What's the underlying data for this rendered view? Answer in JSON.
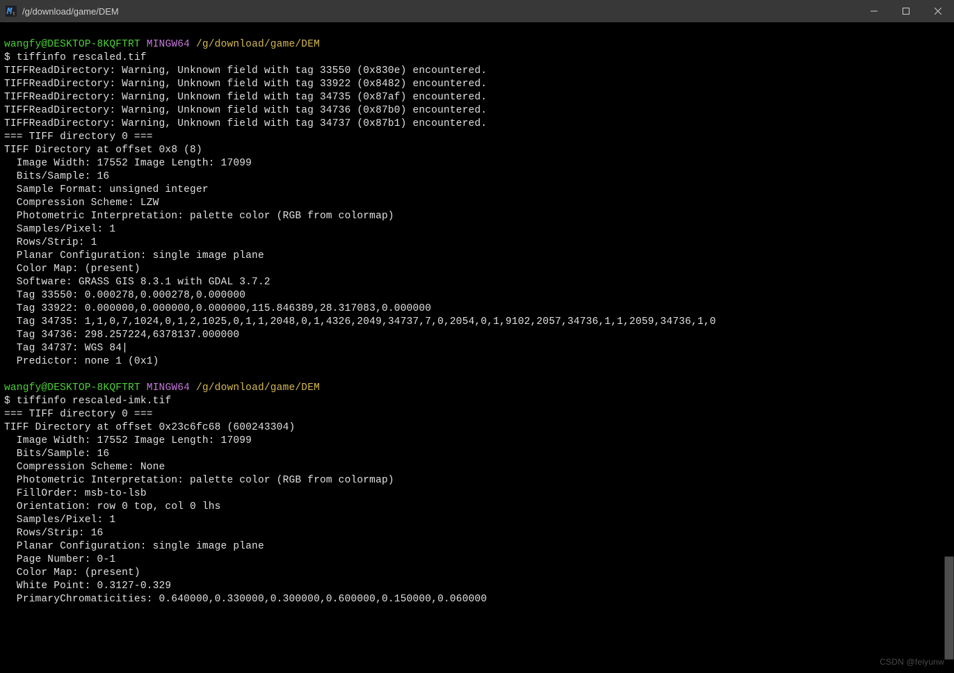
{
  "window": {
    "title": "/g/download/game/DEM",
    "icon_label": "M"
  },
  "prompt": {
    "user_host": "wangfy@DESKTOP-8KQFTRT",
    "system": "MINGW64",
    "cwd": "/g/download/game/DEM",
    "sigil": "$"
  },
  "commands": [
    {
      "cmd": "tiffinfo rescaled.tif"
    },
    {
      "cmd": "tiffinfo rescaled-imk.tif"
    }
  ],
  "output1": [
    "TIFFReadDirectory: Warning, Unknown field with tag 33550 (0x830e) encountered.",
    "TIFFReadDirectory: Warning, Unknown field with tag 33922 (0x8482) encountered.",
    "TIFFReadDirectory: Warning, Unknown field with tag 34735 (0x87af) encountered.",
    "TIFFReadDirectory: Warning, Unknown field with tag 34736 (0x87b0) encountered.",
    "TIFFReadDirectory: Warning, Unknown field with tag 34737 (0x87b1) encountered.",
    "=== TIFF directory 0 ===",
    "TIFF Directory at offset 0x8 (8)",
    "  Image Width: 17552 Image Length: 17099",
    "  Bits/Sample: 16",
    "  Sample Format: unsigned integer",
    "  Compression Scheme: LZW",
    "  Photometric Interpretation: palette color (RGB from colormap)",
    "  Samples/Pixel: 1",
    "  Rows/Strip: 1",
    "  Planar Configuration: single image plane",
    "  Color Map: (present)",
    "  Software: GRASS GIS 8.3.1 with GDAL 3.7.2",
    "  Tag 33550: 0.000278,0.000278,0.000000",
    "  Tag 33922: 0.000000,0.000000,0.000000,115.846389,28.317083,0.000000",
    "  Tag 34735: 1,1,0,7,1024,0,1,2,1025,0,1,1,2048,0,1,4326,2049,34737,7,0,2054,0,1,9102,2057,34736,1,1,2059,34736,1,0",
    "  Tag 34736: 298.257224,6378137.000000",
    "  Tag 34737: WGS 84|",
    "  Predictor: none 1 (0x1)",
    ""
  ],
  "output2": [
    "=== TIFF directory 0 ===",
    "TIFF Directory at offset 0x23c6fc68 (600243304)",
    "  Image Width: 17552 Image Length: 17099",
    "  Bits/Sample: 16",
    "  Compression Scheme: None",
    "  Photometric Interpretation: palette color (RGB from colormap)",
    "  FillOrder: msb-to-lsb",
    "  Orientation: row 0 top, col 0 lhs",
    "  Samples/Pixel: 1",
    "  Rows/Strip: 16",
    "  Planar Configuration: single image plane",
    "  Page Number: 0-1",
    "  Color Map: (present)",
    "  White Point: 0.3127-0.329",
    "  PrimaryChromaticities: 0.640000,0.330000,0.300000,0.600000,0.150000,0.060000"
  ],
  "watermark": "CSDN @feiyunw"
}
